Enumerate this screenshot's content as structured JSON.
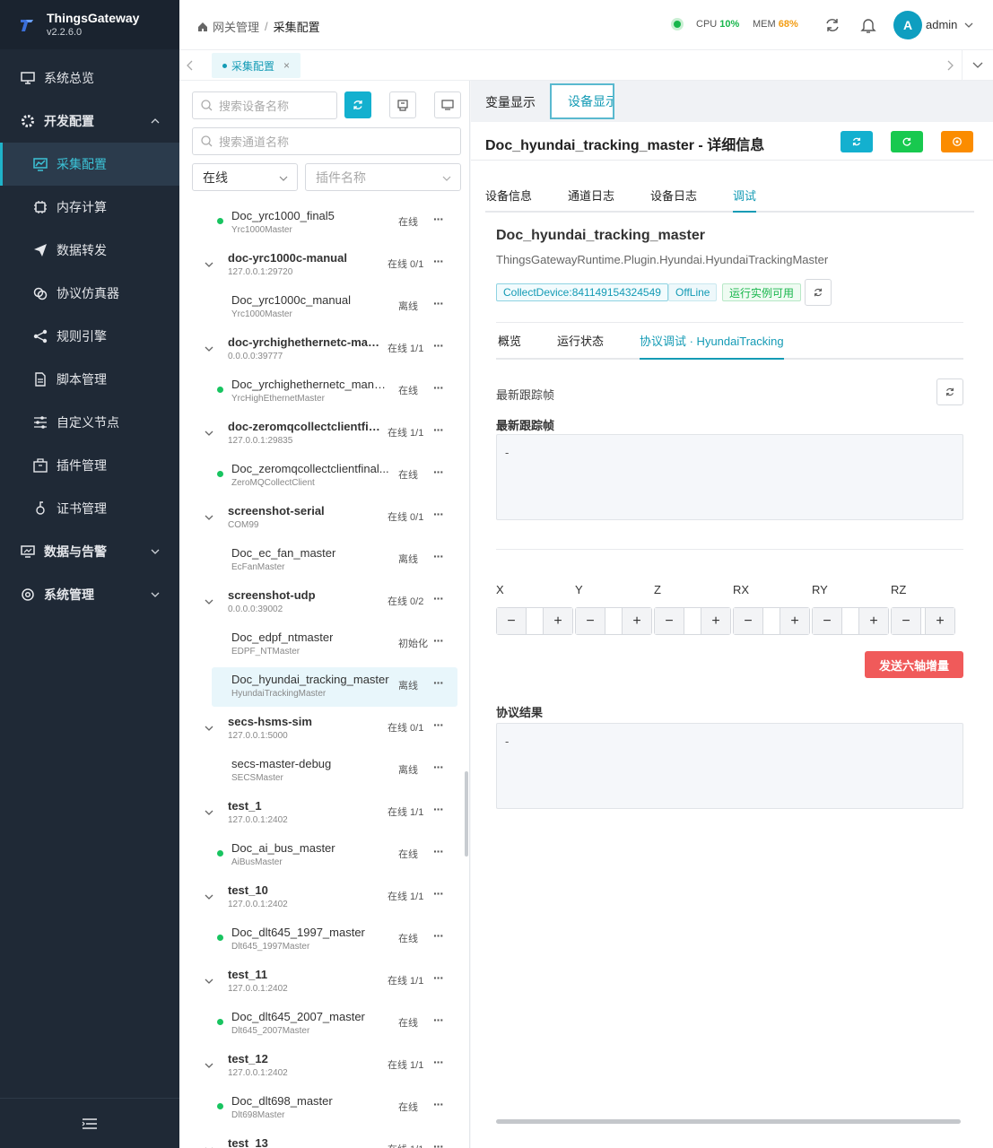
{
  "app": {
    "name": "ThingsGateway",
    "version": "v2.2.6.0"
  },
  "sidebar": {
    "items": [
      {
        "label": "系统总览",
        "icon": "monitor-icon"
      },
      {
        "label": "开发配置",
        "icon": "gear-icon"
      },
      {
        "label": "采集配置",
        "icon": "chart-icon"
      },
      {
        "label": "内存计算",
        "icon": "chip-icon"
      },
      {
        "label": "数据转发",
        "icon": "send-icon"
      },
      {
        "label": "协议仿真器",
        "icon": "link-icon"
      },
      {
        "label": "规则引擎",
        "icon": "share-icon"
      },
      {
        "label": "脚本管理",
        "icon": "file-icon"
      },
      {
        "label": "自定义节点",
        "icon": "sliders-icon"
      },
      {
        "label": "插件管理",
        "icon": "box-icon"
      },
      {
        "label": "证书管理",
        "icon": "cert-icon"
      },
      {
        "label": "数据与告警",
        "icon": "display-icon"
      },
      {
        "label": "系统管理",
        "icon": "cog-icon"
      }
    ]
  },
  "topbar": {
    "breadcrumb": [
      "网关管理",
      "采集配置"
    ],
    "cpu_label": "CPU",
    "cpu": "10%",
    "mem_label": "MEM",
    "mem": "68%",
    "avatar": "A",
    "user": "admin"
  },
  "tabs": {
    "active": "采集配置"
  },
  "left": {
    "search_device_placeholder": "搜索设备名称",
    "search_channel_placeholder": "搜索通道名称",
    "status_select": "在线",
    "plugin_select_placeholder": "插件名称",
    "rows": [
      {
        "type": "ch",
        "name": "Doc_yrc1000_final5",
        "sub": "Yrc1000Master",
        "status": "在线",
        "online": true
      },
      {
        "type": "gr",
        "name": "doc-yrc1000c-manual",
        "sub": "127.0.0.1:29720",
        "status": "在线 0/1"
      },
      {
        "type": "ch",
        "name": "Doc_yrc1000c_manual",
        "sub": "Yrc1000Master",
        "status": "离线",
        "online": false
      },
      {
        "type": "gr",
        "name": "doc-yrchighethernetc-man...",
        "sub": "0.0.0.0:39777",
        "status": "在线 1/1"
      },
      {
        "type": "ch",
        "name": "Doc_yrchighethernetc_manual",
        "sub": "YrcHighEthernetMaster",
        "status": "在线",
        "online": true
      },
      {
        "type": "gr",
        "name": "doc-zeromqcollectclientfin...",
        "sub": "127.0.0.1:29835",
        "status": "在线 1/1"
      },
      {
        "type": "ch",
        "name": "Doc_zeromqcollectclientfinal...",
        "sub": "ZeroMQCollectClient",
        "status": "在线",
        "online": true
      },
      {
        "type": "gr",
        "name": "screenshot-serial",
        "sub": "COM99",
        "status": "在线 0/1"
      },
      {
        "type": "ch",
        "name": "Doc_ec_fan_master",
        "sub": "EcFanMaster",
        "status": "离线",
        "online": false
      },
      {
        "type": "gr",
        "name": "screenshot-udp",
        "sub": "0.0.0.0:39002",
        "status": "在线 0/2"
      },
      {
        "type": "ch",
        "name": "Doc_edpf_ntmaster",
        "sub": "EDPF_NTMaster",
        "status": "初始化",
        "online": false
      },
      {
        "type": "ch",
        "name": "Doc_hyundai_tracking_master",
        "sub": "HyundaiTrackingMaster",
        "status": "离线",
        "online": false,
        "selected": true
      },
      {
        "type": "gr",
        "name": "secs-hsms-sim",
        "sub": "127.0.0.1:5000",
        "status": "在线 0/1"
      },
      {
        "type": "ch",
        "name": "secs-master-debug",
        "sub": "SECSMaster",
        "status": "离线",
        "online": false
      },
      {
        "type": "gr",
        "name": "test_1",
        "sub": "127.0.0.1:2402",
        "status": "在线 1/1"
      },
      {
        "type": "ch",
        "name": "Doc_ai_bus_master",
        "sub": "AiBusMaster",
        "status": "在线",
        "online": true
      },
      {
        "type": "gr",
        "name": "test_10",
        "sub": "127.0.0.1:2402",
        "status": "在线 1/1"
      },
      {
        "type": "ch",
        "name": "Doc_dlt645_1997_master",
        "sub": "Dlt645_1997Master",
        "status": "在线",
        "online": true
      },
      {
        "type": "gr",
        "name": "test_11",
        "sub": "127.0.0.1:2402",
        "status": "在线 1/1"
      },
      {
        "type": "ch",
        "name": "Doc_dlt645_2007_master",
        "sub": "Dlt645_2007Master",
        "status": "在线",
        "online": true
      },
      {
        "type": "gr",
        "name": "test_12",
        "sub": "127.0.0.1:2402",
        "status": "在线 1/1"
      },
      {
        "type": "ch",
        "name": "Doc_dlt698_master",
        "sub": "Dlt698Master",
        "status": "在线",
        "online": true
      },
      {
        "type": "gr",
        "name": "test_13",
        "sub": "",
        "status": "在线 1/1"
      }
    ]
  },
  "right": {
    "view_tabs": [
      "变量显示",
      "设备显示"
    ],
    "detail_title": "Doc_hyundai_tracking_master - 详细信息",
    "sub_tabs": [
      "设备信息",
      "通道日志",
      "设备日志",
      "调试"
    ],
    "device": {
      "name": "Doc_hyundai_tracking_master",
      "namespace": "ThingsGatewayRuntime.Plugin.Hyundai.HyundaiTrackingMaster",
      "tag_device": "CollectDevice:841149154324549",
      "tag_offline": "OffLine",
      "tag_runtime": "运行实例可用"
    },
    "panel_tabs": [
      "概览",
      "运行状态",
      "协议调试 · HyundaiTracking"
    ],
    "latest_frame_label": "最新跟踪帧",
    "latest_frame_title": "最新跟踪帧",
    "latest_frame_value": "-",
    "axes": [
      "X",
      "Y",
      "Z",
      "RX",
      "RY",
      "RZ"
    ],
    "send_button": "发送六轴增量",
    "result_label": "协议结果",
    "result_value": "-"
  },
  "colors": {
    "accent": "#149bb5",
    "sidebar_bg": "#1f2936",
    "online": "#18c460",
    "danger": "#f05a5a",
    "btn_cyan": "#13b0cf",
    "btn_green": "#18c94f",
    "btn_orange": "#fb8c00"
  }
}
